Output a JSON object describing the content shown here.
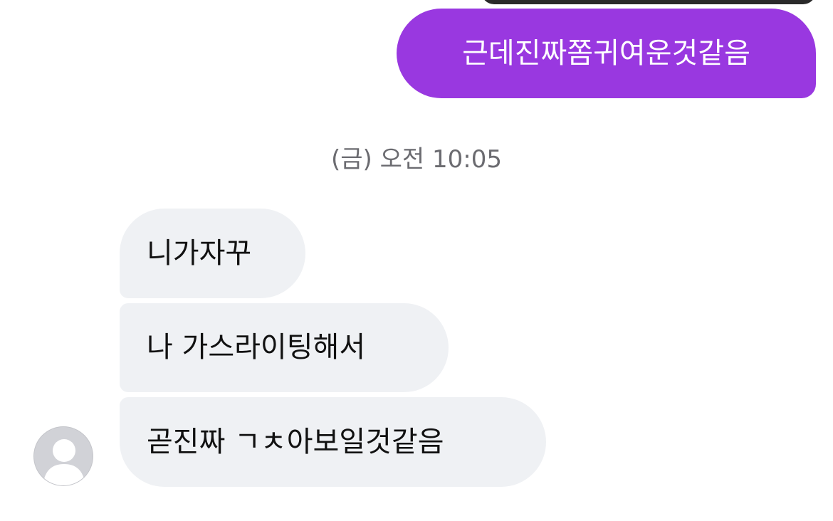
{
  "messages": [
    {
      "direction": "outgoing",
      "text": "근데진짜쫌귀여운것같음"
    },
    {
      "direction": "incoming",
      "text": "니가자꾸"
    },
    {
      "direction": "incoming",
      "text": "나 가스라이팅해서"
    },
    {
      "direction": "incoming",
      "text": "곧진짜 ㄱㅊ아보일것같음"
    }
  ],
  "timestamp": "(금) 오전 10:05",
  "colors": {
    "outgoing_bubble": "#9938e0",
    "incoming_bubble": "#eff1f4",
    "timestamp_text": "#6b6b70"
  },
  "icons": {
    "avatar": "default-person-avatar"
  }
}
